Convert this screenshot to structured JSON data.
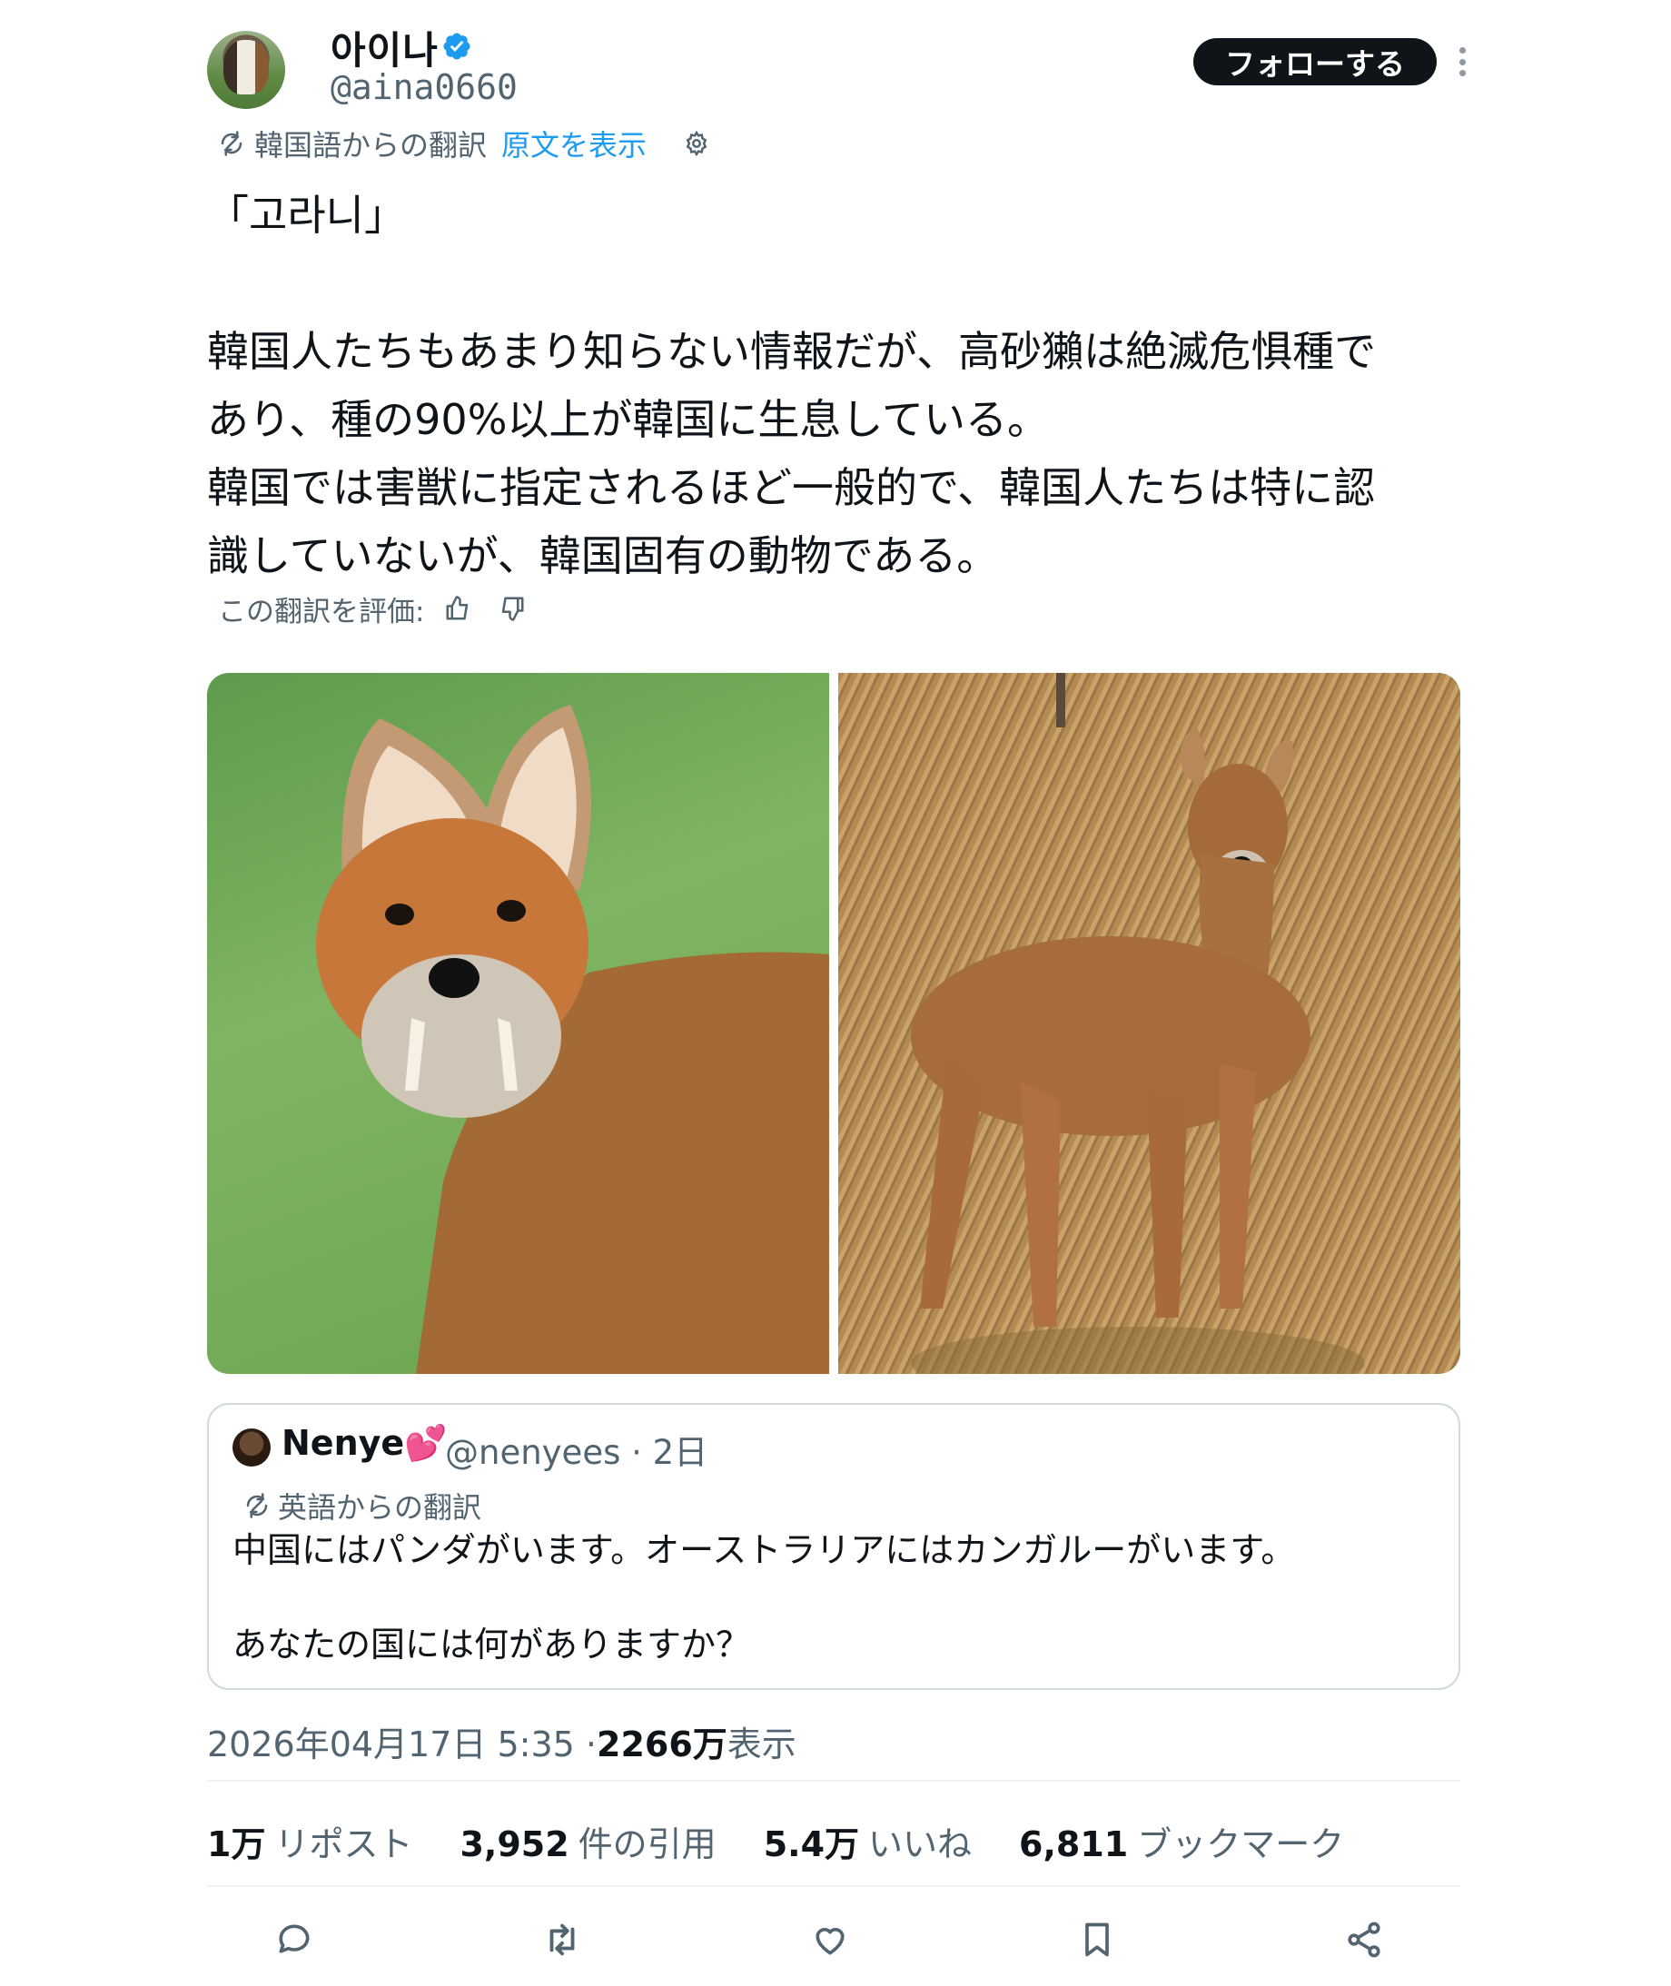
{
  "author": {
    "display_name": "아이나",
    "handle": "@aina0660",
    "verified": true
  },
  "follow_label": "フォローする",
  "translation": {
    "source": "韓国語からの翻訳",
    "show_original": "原文を表示"
  },
  "tweet_text": "「고라니」\n\n韓国人たちもあまり知らない情報だが、高砂獺は絶滅危惧種で\nあり、種の90%以上が韓国に生息している。\n韓国では害獣に指定されるほど一般的で、韓国人たちは特に認\n識していないが、韓国固有の動物である。",
  "rate_translation": "この翻訳を評価:",
  "quote": {
    "name": "Nenye",
    "name_emoji": "💕",
    "handle_time": "@nenyees · 2日",
    "translation_source": "英語からの翻訳",
    "text": "中国にはパンダがいます。オーストラリアにはカンガルーがいます。\n\nあなたの国には何がありますか？"
  },
  "meta": {
    "datetime": "2026年04月17日 5:35 · ",
    "views": "2266万",
    "views_label": " 表示"
  },
  "stats": {
    "reposts_count": "1万",
    "reposts_label": "リポスト",
    "quotes_count": "3,952",
    "quotes_label": "件の引用",
    "likes_count": "5.4万",
    "likes_label": "いいね",
    "bookmarks_count": "6,811",
    "bookmarks_label": "ブックマーク"
  },
  "colors": {
    "accent": "#1d9bf0",
    "text": "#0f1419",
    "secondary": "#536471"
  },
  "icons": [
    "verified-badge-icon",
    "translate-icon",
    "gear-icon",
    "thumbs-up-icon",
    "thumbs-down-icon",
    "reply-icon",
    "repost-icon",
    "like-icon",
    "bookmark-icon",
    "share-icon",
    "more-icon"
  ]
}
